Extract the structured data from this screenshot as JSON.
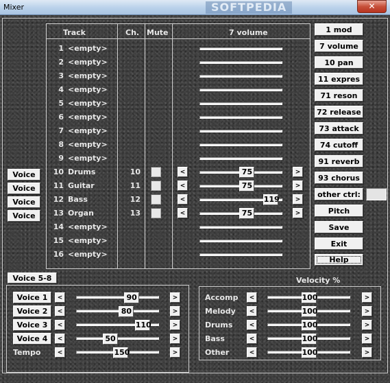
{
  "window": {
    "title": "Mixer",
    "watermark": "SOFTPEDIA",
    "close_glyph": "✕"
  },
  "table": {
    "headers": {
      "track": "Track",
      "ch": "Ch.",
      "mute": "Mute",
      "volume": "7 volume"
    },
    "rows": [
      {
        "num": "1",
        "name": "<empty>",
        "active": false
      },
      {
        "num": "2",
        "name": "<empty>",
        "active": false
      },
      {
        "num": "3",
        "name": "<empty>",
        "active": false
      },
      {
        "num": "4",
        "name": "<empty>",
        "active": false
      },
      {
        "num": "5",
        "name": "<empty>",
        "active": false
      },
      {
        "num": "6",
        "name": "<empty>",
        "active": false
      },
      {
        "num": "7",
        "name": "<empty>",
        "active": false
      },
      {
        "num": "8",
        "name": "<empty>",
        "active": false
      },
      {
        "num": "9",
        "name": "<empty>",
        "active": false
      },
      {
        "num": "10",
        "name": "Drums",
        "active": true,
        "ch": "10",
        "volume": 75,
        "value_text": "75"
      },
      {
        "num": "11",
        "name": "Guitar",
        "active": true,
        "ch": "11",
        "volume": 75,
        "value_text": "75"
      },
      {
        "num": "12",
        "name": "Bass",
        "active": true,
        "ch": "12",
        "volume": 119,
        "value_text": "119"
      },
      {
        "num": "13",
        "name": "Organ",
        "active": true,
        "ch": "13",
        "volume": 75,
        "value_text": "75"
      },
      {
        "num": "14",
        "name": "<empty>",
        "active": false
      },
      {
        "num": "15",
        "name": "<empty>",
        "active": false
      },
      {
        "num": "16",
        "name": "<empty>",
        "active": false
      }
    ],
    "volume_max": 127,
    "dec_glyph": "<",
    "inc_glyph": ">"
  },
  "voice_buttons": [
    "Voice",
    "Voice",
    "Voice",
    "Voice"
  ],
  "controller_buttons": [
    "1 mod",
    "7 volume",
    "10 pan",
    "11 expres",
    "71 reson",
    "72 release",
    "73 attack",
    "74 cutoff",
    "91 reverb",
    "93 chorus"
  ],
  "other_ctrl": {
    "label": "other ctrl:",
    "value": ""
  },
  "action_buttons": {
    "pitch": "Pitch",
    "save": "Save",
    "exit": "Exit",
    "help": "Help"
  },
  "voice58": {
    "tab_label": "Voice 5-8",
    "rows": [
      {
        "label": "Voice 1",
        "value": 90,
        "value_text": "90"
      },
      {
        "label": "Voice 2",
        "value": 80,
        "value_text": "80"
      },
      {
        "label": "Voice 3",
        "value": 110,
        "value_text": "110"
      },
      {
        "label": "Voice 4",
        "value": 50,
        "value_text": "50"
      }
    ],
    "tempo": {
      "label": "Tempo",
      "value": 150,
      "value_text": "150",
      "min": 40,
      "max": 240
    }
  },
  "velocity": {
    "title": "Velocity %",
    "rows": [
      {
        "label": "Accomp",
        "value": 100,
        "value_text": "100"
      },
      {
        "label": "Melody",
        "value": 100,
        "value_text": "100"
      },
      {
        "label": "Drums",
        "value": 100,
        "value_text": "100"
      },
      {
        "label": "Bass",
        "value": 100,
        "value_text": "100"
      },
      {
        "label": "Other",
        "value": 100,
        "value_text": "100"
      }
    ],
    "max": 200
  }
}
